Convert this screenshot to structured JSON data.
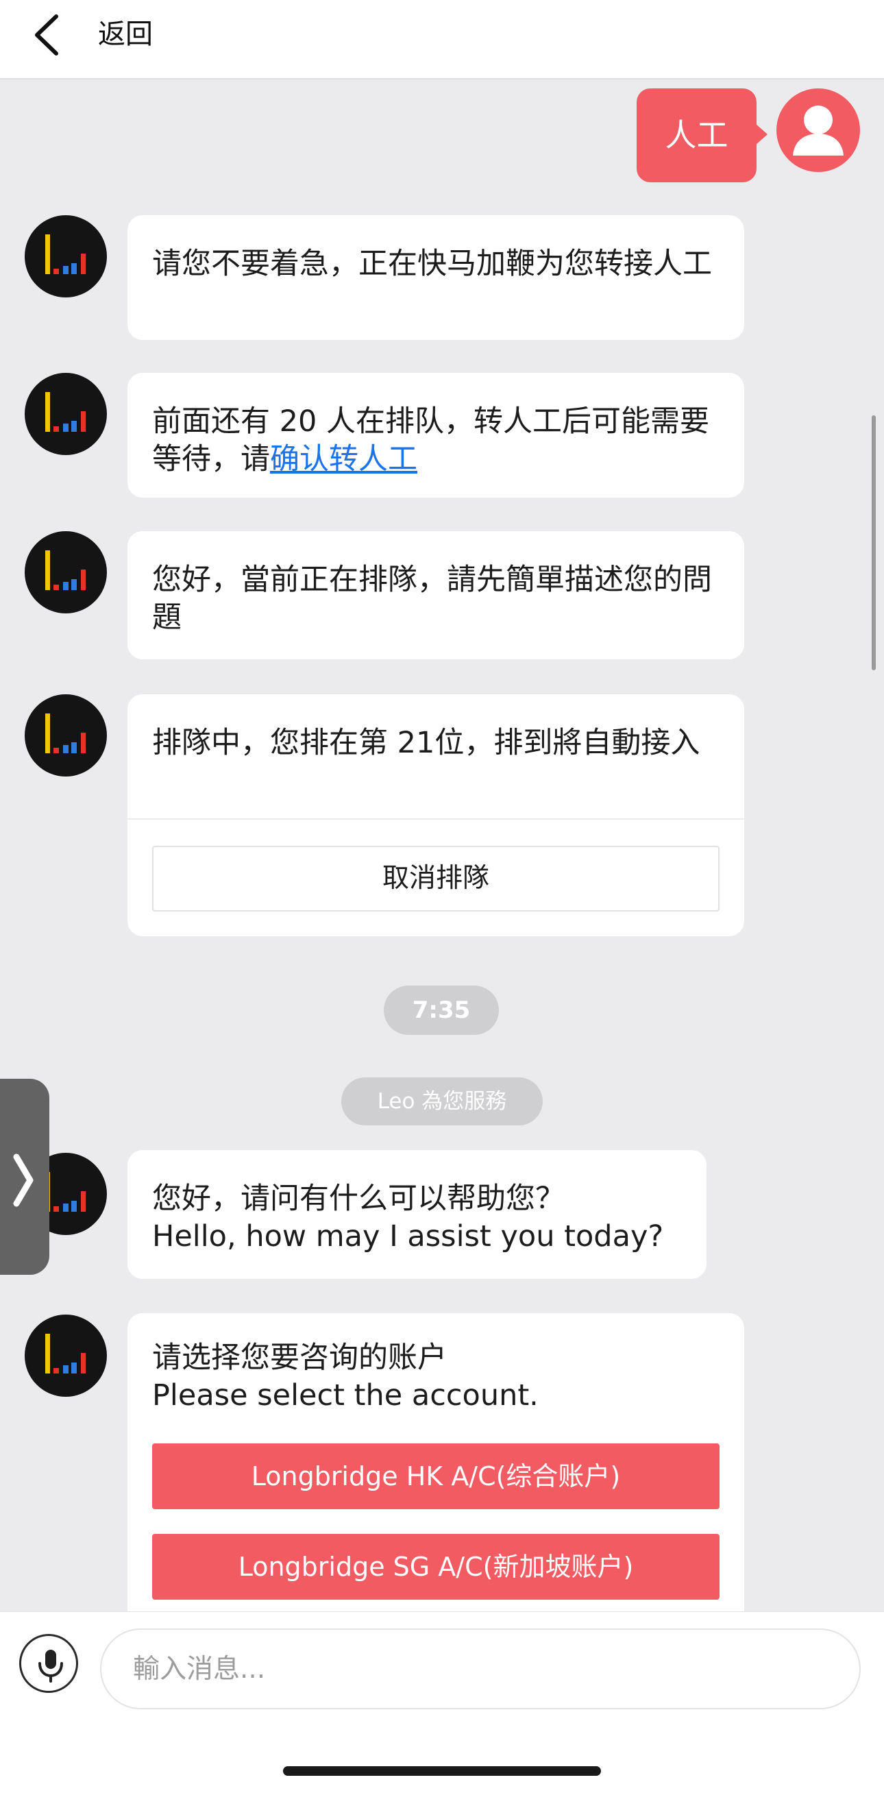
{
  "header": {
    "back_label": "返回"
  },
  "user_message": {
    "text": "人工"
  },
  "messages": [
    {
      "text": "请您不要着急，正在快马加鞭为您转接人工"
    },
    {
      "text_prefix": "前面还有 20 人在排队，转人工后可能需要等待，请",
      "link": "确认转人工"
    },
    {
      "text": "您好，當前正在排隊，請先簡單描述您的問題"
    },
    {
      "text": "排隊中，您排在第 21位，排到將自動接入",
      "button": "取消排隊"
    },
    {
      "text": "您好，请问有什么可以帮助您？\nHello, how may I assist you today?"
    },
    {
      "text": "请选择您要咨询的账户\nPlease select the account.",
      "options": [
        "Longbridge HK A/C(综合账户)",
        "Longbridge SG A/C(新加坡账户)"
      ]
    }
  ],
  "system": {
    "time": "7:35",
    "agent_notice": "Leo 為您服務"
  },
  "input": {
    "placeholder": "輸入消息..."
  },
  "colors": {
    "accent": "#f35b62",
    "chat_bg": "#ebebed",
    "link": "#1a73e8",
    "logo_yellow": "#f5c400",
    "logo_blue": "#2f7de1",
    "logo_red": "#e8312a"
  },
  "icons": [
    "chevron-left-icon",
    "brand-logo-icon",
    "user-icon",
    "chevron-right-icon",
    "microphone-icon"
  ]
}
